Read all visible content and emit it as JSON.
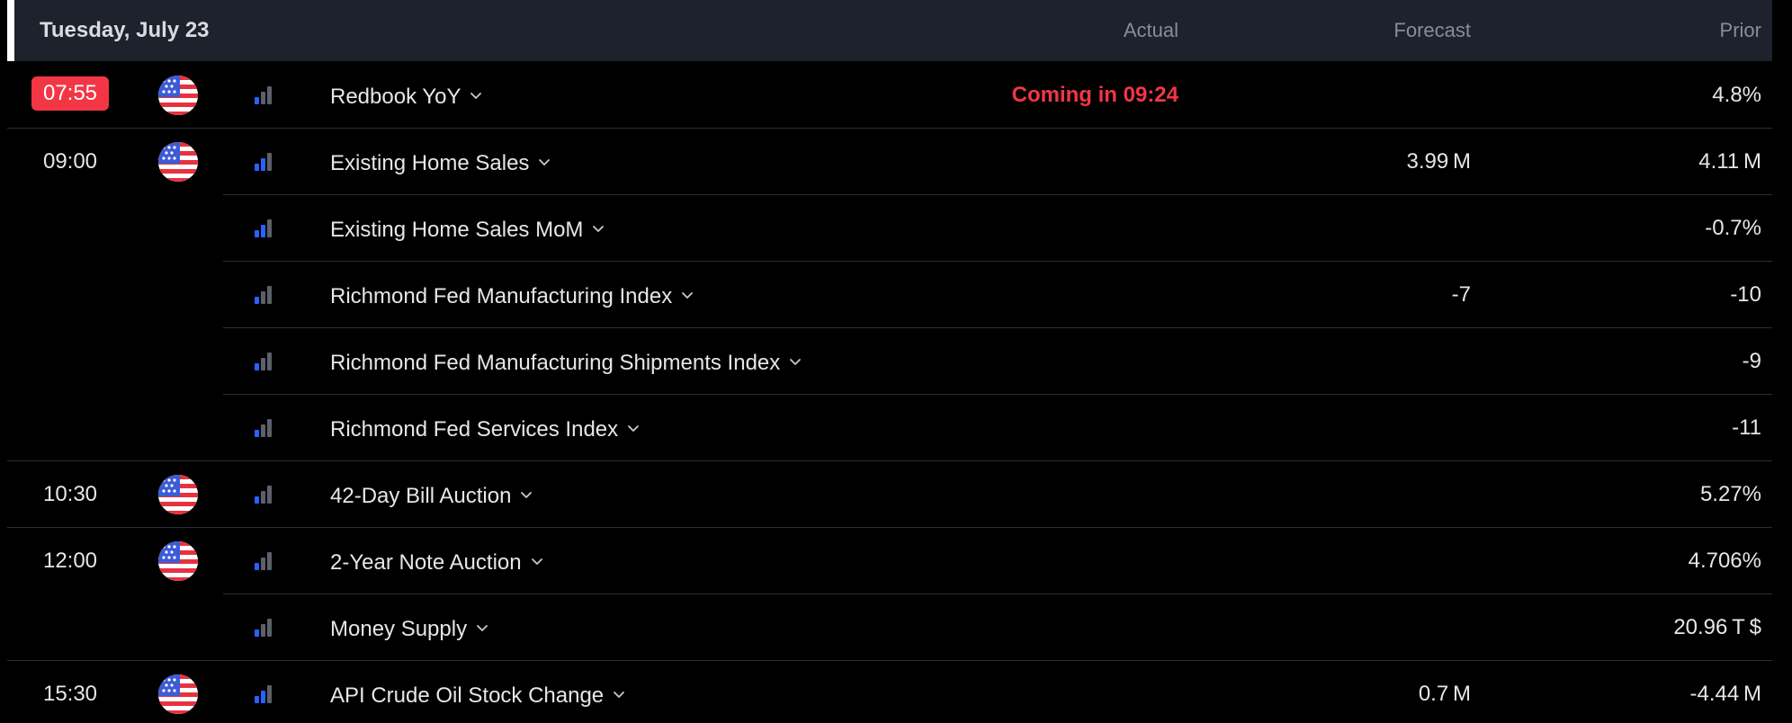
{
  "header": {
    "date": "Tuesday, July 23",
    "col_actual": "Actual",
    "col_forecast": "Forecast",
    "col_prior": "Prior"
  },
  "colors": {
    "live_badge": "#f23645",
    "countdown": "#f23645",
    "bar_active": "#2962ff",
    "bar_inactive": "#5d606b"
  },
  "events": [
    {
      "time": "07:55",
      "live": true,
      "event": "Redbook YoY",
      "actual": "Coming in 09:24",
      "forecast": "",
      "prior": "4.8%",
      "importance": 1
    },
    {
      "time": "09:00",
      "event": "Existing Home Sales",
      "actual": "",
      "forecast": "3.99 M",
      "prior": "4.11 M",
      "importance": 2
    },
    {
      "time": "",
      "event": "Existing Home Sales MoM",
      "actual": "",
      "forecast": "",
      "prior": "-0.7%",
      "importance": 2
    },
    {
      "time": "",
      "event": "Richmond Fed Manufacturing Index",
      "actual": "",
      "forecast": "-7",
      "prior": "-10",
      "importance": 1
    },
    {
      "time": "",
      "event": "Richmond Fed Manufacturing Shipments Index",
      "actual": "",
      "forecast": "",
      "prior": "-9",
      "importance": 1
    },
    {
      "time": "",
      "event": "Richmond Fed Services Index",
      "actual": "",
      "forecast": "",
      "prior": "-11",
      "importance": 1
    },
    {
      "time": "10:30",
      "event": "42-Day Bill Auction",
      "actual": "",
      "forecast": "",
      "prior": "5.27%",
      "importance": 1
    },
    {
      "time": "12:00",
      "event": "2-Year Note Auction",
      "actual": "",
      "forecast": "",
      "prior": "4.706%",
      "importance": 1
    },
    {
      "time": "",
      "event": "Money Supply",
      "actual": "",
      "forecast": "",
      "prior": "20.96 T $",
      "importance": 1
    },
    {
      "time": "15:30",
      "event": "API Crude Oil Stock Change",
      "actual": "",
      "forecast": "0.7 M",
      "prior": "-4.44 M",
      "importance": 2
    }
  ]
}
